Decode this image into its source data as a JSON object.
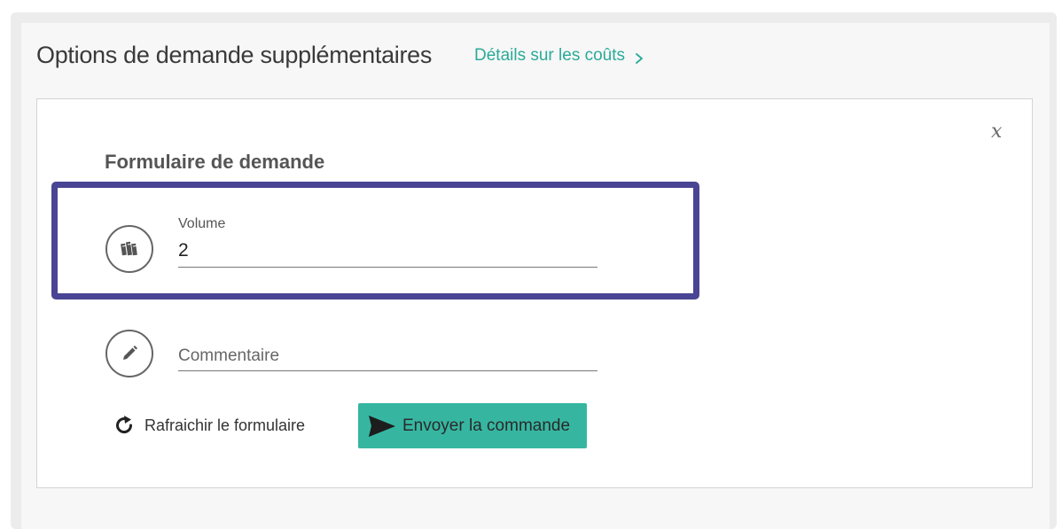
{
  "header": {
    "title": "Options de demande supplémentaires",
    "cost_link": "Détails sur les coûts",
    "cost_link_icon": "chevron-right-icon"
  },
  "form": {
    "close_label": "x",
    "title": "Formulaire de demande",
    "volume": {
      "label": "Volume",
      "value": "2",
      "icon": "books-icon"
    },
    "comment": {
      "placeholder": "Commentaire",
      "value": "",
      "icon": "pencil-icon"
    },
    "refresh": {
      "label": "Rafraichir le formulaire",
      "icon": "refresh-icon"
    },
    "submit": {
      "label": "Envoyer la commande",
      "icon": "send-icon"
    }
  },
  "colors": {
    "accent": "#36b6a1",
    "link": "#2aaa98",
    "highlight": "#4a4494"
  }
}
